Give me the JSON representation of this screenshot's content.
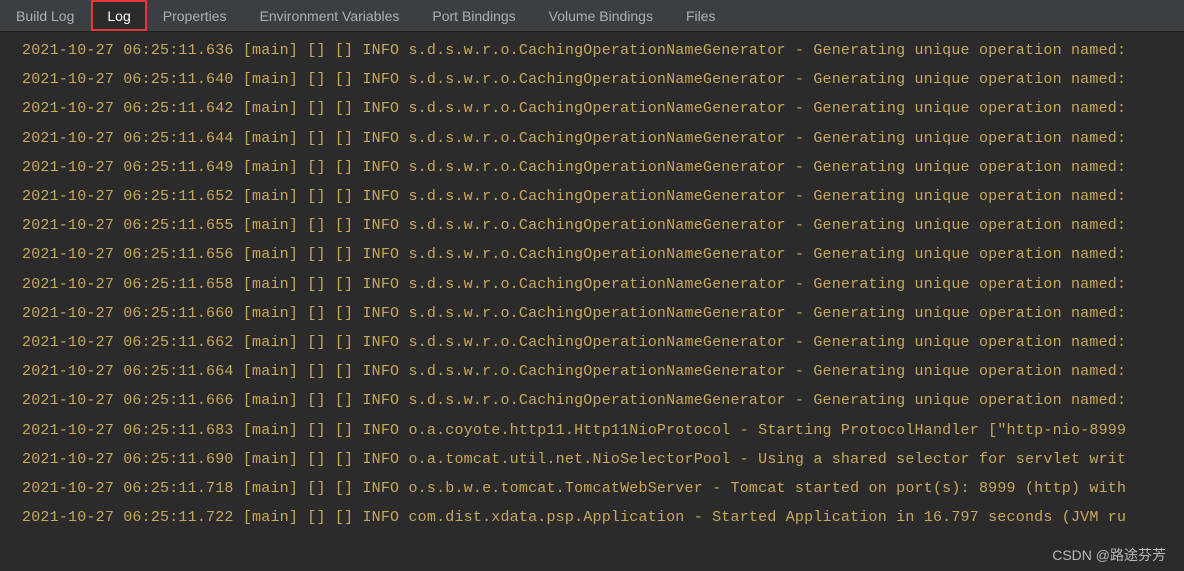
{
  "tabs": [
    {
      "label": "Build Log",
      "active": false
    },
    {
      "label": "Log",
      "active": true
    },
    {
      "label": "Properties",
      "active": false
    },
    {
      "label": "Environment Variables",
      "active": false
    },
    {
      "label": "Port Bindings",
      "active": false
    },
    {
      "label": "Volume Bindings",
      "active": false
    },
    {
      "label": "Files",
      "active": false
    }
  ],
  "log_lines": [
    "2021-10-27 06:25:11.636 [main] [] [] INFO  s.d.s.w.r.o.CachingOperationNameGenerator - Generating unique operation named:",
    "2021-10-27 06:25:11.640 [main] [] [] INFO  s.d.s.w.r.o.CachingOperationNameGenerator - Generating unique operation named:",
    "2021-10-27 06:25:11.642 [main] [] [] INFO  s.d.s.w.r.o.CachingOperationNameGenerator - Generating unique operation named:",
    "2021-10-27 06:25:11.644 [main] [] [] INFO  s.d.s.w.r.o.CachingOperationNameGenerator - Generating unique operation named:",
    "2021-10-27 06:25:11.649 [main] [] [] INFO  s.d.s.w.r.o.CachingOperationNameGenerator - Generating unique operation named:",
    "2021-10-27 06:25:11.652 [main] [] [] INFO  s.d.s.w.r.o.CachingOperationNameGenerator - Generating unique operation named:",
    "2021-10-27 06:25:11.655 [main] [] [] INFO  s.d.s.w.r.o.CachingOperationNameGenerator - Generating unique operation named:",
    "2021-10-27 06:25:11.656 [main] [] [] INFO  s.d.s.w.r.o.CachingOperationNameGenerator - Generating unique operation named:",
    "2021-10-27 06:25:11.658 [main] [] [] INFO  s.d.s.w.r.o.CachingOperationNameGenerator - Generating unique operation named:",
    "2021-10-27 06:25:11.660 [main] [] [] INFO  s.d.s.w.r.o.CachingOperationNameGenerator - Generating unique operation named:",
    "2021-10-27 06:25:11.662 [main] [] [] INFO  s.d.s.w.r.o.CachingOperationNameGenerator - Generating unique operation named:",
    "2021-10-27 06:25:11.664 [main] [] [] INFO  s.d.s.w.r.o.CachingOperationNameGenerator - Generating unique operation named:",
    "2021-10-27 06:25:11.666 [main] [] [] INFO  s.d.s.w.r.o.CachingOperationNameGenerator - Generating unique operation named:",
    "2021-10-27 06:25:11.683 [main] [] [] INFO  o.a.coyote.http11.Http11NioProtocol - Starting ProtocolHandler [\"http-nio-8999",
    "2021-10-27 06:25:11.690 [main] [] [] INFO  o.a.tomcat.util.net.NioSelectorPool - Using a shared selector for servlet writ",
    "2021-10-27 06:25:11.718 [main] [] [] INFO  o.s.b.w.e.tomcat.TomcatWebServer - Tomcat started on port(s): 8999 (http) with",
    "2021-10-27 06:25:11.722 [main] [] [] INFO  com.dist.xdata.psp.Application - Started Application in 16.797 seconds (JVM ru"
  ],
  "watermark": "CSDN @路途芬芳"
}
